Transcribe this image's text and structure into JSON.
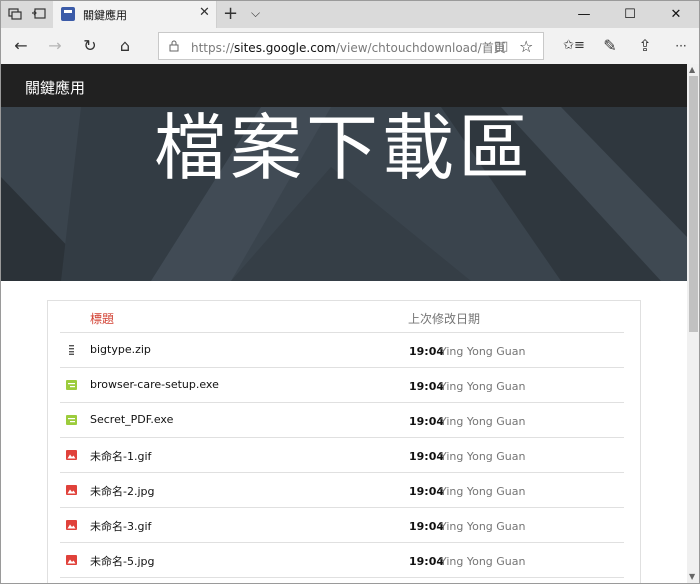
{
  "browser": {
    "tab_title": "關鍵應用",
    "close_glyph": "✕",
    "newtab_glyph": "+",
    "tabdrop_glyph": "⌵",
    "minimize_glyph": "—",
    "maximize_glyph": "☐",
    "close_window_glyph": "✕",
    "back_glyph": "←",
    "forward_glyph": "→",
    "refresh_glyph": "↻",
    "home_glyph": "⌂",
    "url_prefix": "https://",
    "url_host": "sites.google.com",
    "url_path": "/view/chtouchdownload/首頁",
    "reading_glyph": "▯▯",
    "favorite_glyph": "☆",
    "hub_glyph": "✩≡",
    "notes_glyph": "✎",
    "share_glyph": "⇪",
    "more_glyph": "···"
  },
  "site": {
    "name": "關鍵應用",
    "banner_title": "檔案下載區"
  },
  "table": {
    "header_title": "標題",
    "header_date": "上次修改日期",
    "rows": [
      {
        "name": "bigtype.zip",
        "time": "19:04",
        "user": "Ying Yong Guan",
        "icon": "zip-file-icon"
      },
      {
        "name": "browser-care-setup.exe",
        "time": "19:04",
        "user": "Ying Yong Guan",
        "icon": "exe-file-icon"
      },
      {
        "name": "Secret_PDF.exe",
        "time": "19:04",
        "user": "Ying Yong Guan",
        "icon": "exe-file-icon"
      },
      {
        "name": "未命名-1.gif",
        "time": "19:04",
        "user": "Ying Yong Guan",
        "icon": "image-file-icon"
      },
      {
        "name": "未命名-2.jpg",
        "time": "19:04",
        "user": "Ying Yong Guan",
        "icon": "image-file-icon"
      },
      {
        "name": "未命名-3.gif",
        "time": "19:04",
        "user": "Ying Yong Guan",
        "icon": "image-file-icon"
      },
      {
        "name": "未命名-5.jpg",
        "time": "19:04",
        "user": "Ying Yong Guan",
        "icon": "image-file-icon"
      }
    ]
  },
  "colors": {
    "header_bg": "#212121",
    "banner_bg": "#37414a",
    "accent_red": "#d23f31",
    "exe_green": "#9ccc3c",
    "image_red": "#e0413a"
  }
}
